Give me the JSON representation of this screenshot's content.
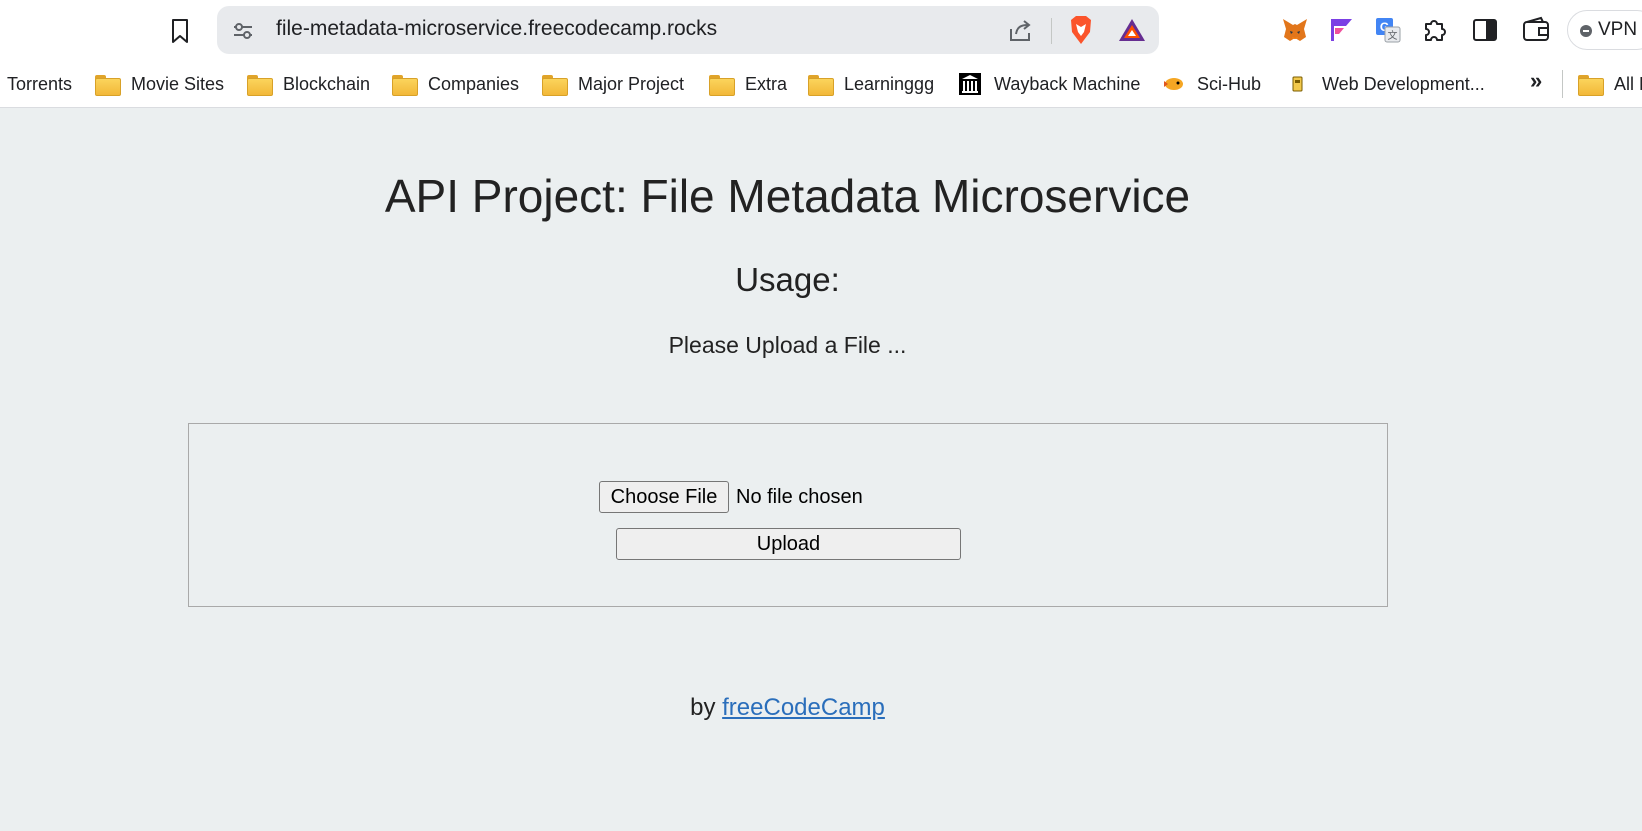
{
  "browser": {
    "url": "file-metadata-microservice.freecodecamp.rocks",
    "vpn_label": "VPN",
    "icons": [
      "bookmark-icon",
      "site-settings-icon",
      "share-icon",
      "brave-shields-icon",
      "brave-rewards-icon",
      "metamask-icon",
      "flowbite-icon",
      "google-translate-icon",
      "extensions-icon",
      "sidebar-icon",
      "wallet-icon"
    ]
  },
  "bookmarks": {
    "items": [
      {
        "label": "Torrents",
        "icon": "none"
      },
      {
        "label": "Movie Sites",
        "icon": "folder-icon"
      },
      {
        "label": "Blockchain",
        "icon": "folder-icon"
      },
      {
        "label": "Companies",
        "icon": "folder-icon"
      },
      {
        "label": "Major Project",
        "icon": "folder-icon"
      },
      {
        "label": "Extra",
        "icon": "folder-icon"
      },
      {
        "label": "Learninggg",
        "icon": "folder-icon"
      },
      {
        "label": "Wayback Machine",
        "icon": "wayback-icon"
      },
      {
        "label": "Sci-Hub",
        "icon": "scihub-icon"
      },
      {
        "label": "Web Development...",
        "icon": "webdev-icon"
      }
    ],
    "overflow": "»",
    "all_bookmarks": "All B"
  },
  "page": {
    "title": "API Project: File Metadata Microservice",
    "subtitle": "Usage:",
    "prompt": "Please Upload a File ...",
    "file_input": {
      "button_label": "Choose File",
      "status": "No file chosen"
    },
    "upload_label": "Upload",
    "footer_by": "by",
    "footer_link": "freeCodeCamp"
  },
  "colors": {
    "page_background": "#ebeff0",
    "link": "#2a6ebb",
    "text": "#222222"
  }
}
